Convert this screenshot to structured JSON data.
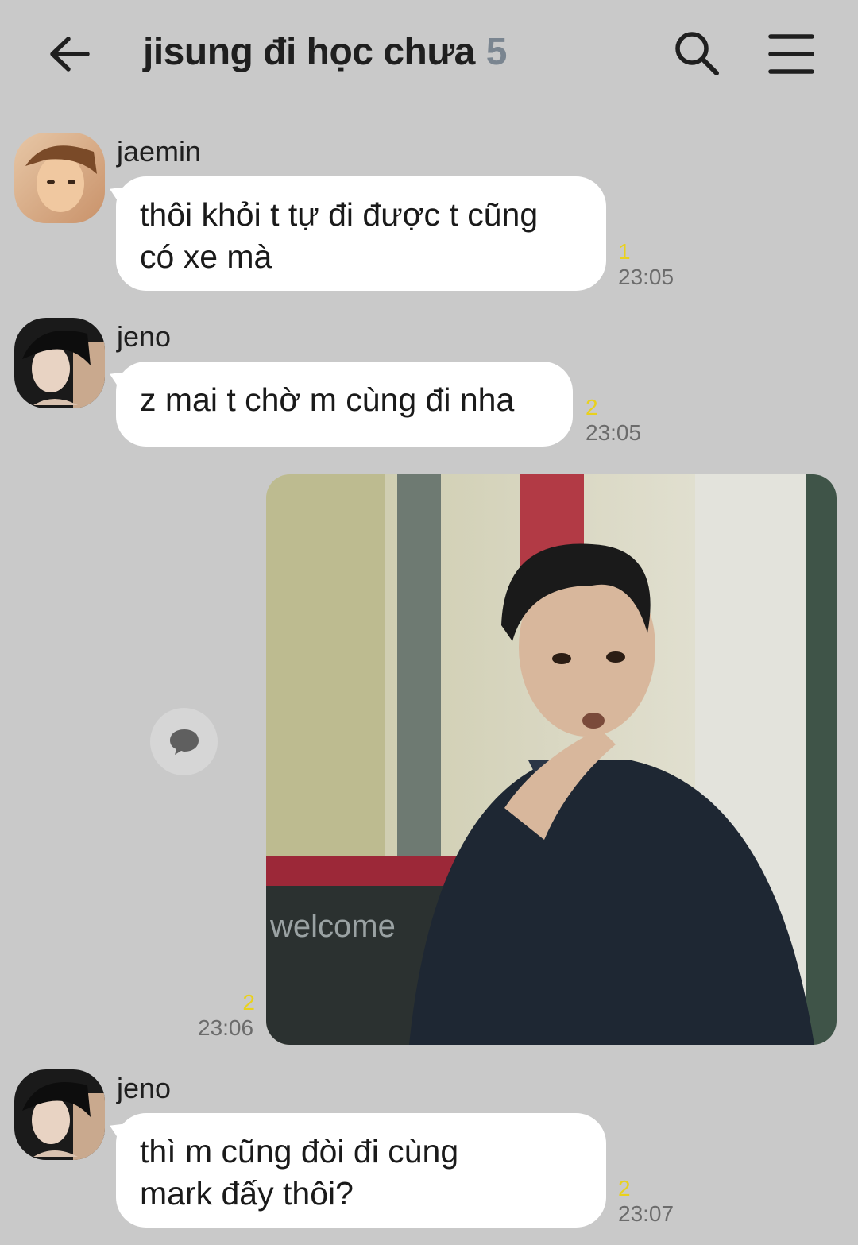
{
  "header": {
    "title": "jisung đi học chưa",
    "member_count": "5",
    "back_icon": "arrow-left-icon",
    "search_icon": "search-icon",
    "menu_icon": "menu-icon"
  },
  "messages": [
    {
      "sender": "jaemin",
      "lines": [
        "thôi khỏi t tự đi được t cũng",
        "có xe mà"
      ],
      "unread": "1",
      "time": "23:05"
    },
    {
      "sender": "jeno",
      "lines": [
        "z mai t chờ m cùng đi nha"
      ],
      "unread": "2",
      "time": "23:05"
    },
    {
      "sender": "me",
      "type": "image",
      "image_text": "welcome",
      "unread": "2",
      "time": "23:06"
    },
    {
      "sender": "jeno",
      "lines": [
        "thì m cũng đòi đi cùng",
        "mark đấy thôi?"
      ],
      "unread": "2",
      "time": "23:07"
    }
  ],
  "colors": {
    "background": "#c9c9c9",
    "bubble": "#ffffff",
    "unread": "#e9d11c",
    "time": "#6b6b6b"
  }
}
